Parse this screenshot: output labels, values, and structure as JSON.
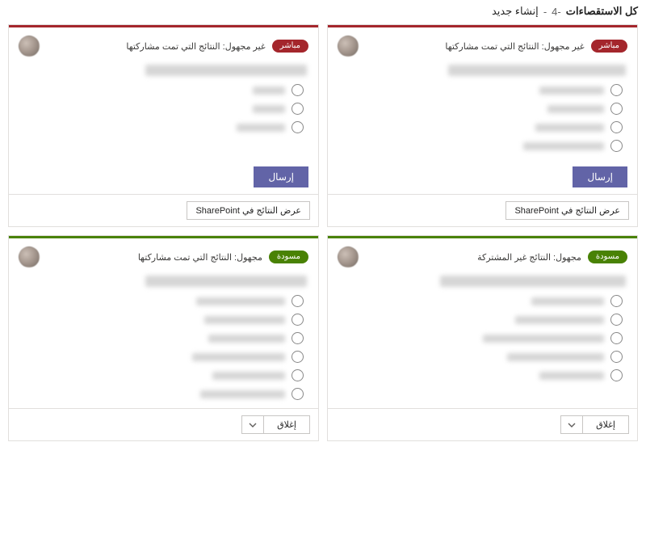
{
  "header": {
    "title": "كل الاستقصاءات",
    "count": "-4",
    "separator": "-",
    "create_new": "إنشاء جديد"
  },
  "common": {
    "send": "إرسال",
    "view_results": "عرض النتائج في SharePoint",
    "close": "إغلاق"
  },
  "cards": [
    {
      "color": "red",
      "badge": "مباشر",
      "status": "غير مجهول: النتائج التي تمت مشاركتها",
      "title_blur_w": 220,
      "options_w": [
        80,
        70,
        85,
        100
      ],
      "footer": "sharepoint"
    },
    {
      "color": "red",
      "badge": "مباشر",
      "status": "غير مجهول: النتائج التي تمت مشاركتها",
      "title_blur_w": 200,
      "options_w": [
        40,
        40,
        60
      ],
      "footer": "sharepoint"
    },
    {
      "color": "green",
      "badge": "مسودة",
      "status": "مجهول: النتائج غير المشتركة",
      "title_blur_w": 230,
      "options_w": [
        90,
        110,
        150,
        120,
        80
      ],
      "footer": "close"
    },
    {
      "color": "green",
      "badge": "مسودة",
      "status": "مجهول: النتائج التي تمت مشاركتها",
      "title_blur_w": 200,
      "options_w": [
        110,
        100,
        95,
        115,
        90,
        105
      ],
      "footer": "close"
    }
  ]
}
